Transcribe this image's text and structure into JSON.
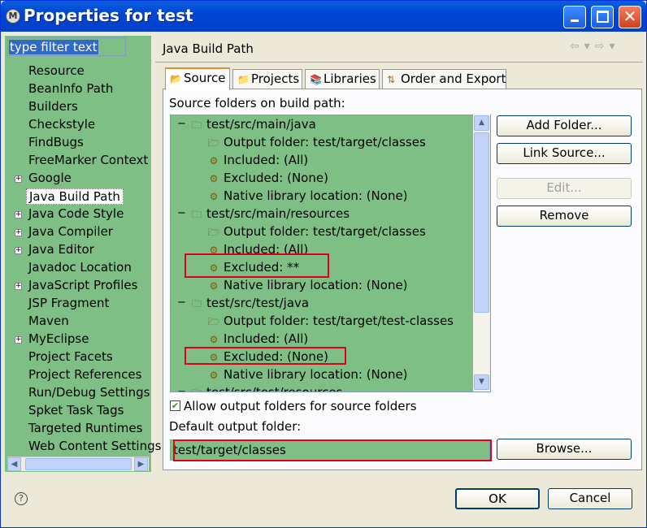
{
  "window": {
    "title": "Properties for test",
    "icon": "eclipse-icon"
  },
  "filter": {
    "placeholder": "type filter text"
  },
  "nav": {
    "items": [
      {
        "label": "Resource",
        "expandable": false
      },
      {
        "label": "BeanInfo Path",
        "expandable": false
      },
      {
        "label": "Builders",
        "expandable": false
      },
      {
        "label": "Checkstyle",
        "expandable": false
      },
      {
        "label": "FindBugs",
        "expandable": false
      },
      {
        "label": "FreeMarker Context",
        "expandable": false
      },
      {
        "label": "Google",
        "expandable": true
      },
      {
        "label": "Java Build Path",
        "expandable": false,
        "selected": true
      },
      {
        "label": "Java Code Style",
        "expandable": true
      },
      {
        "label": "Java Compiler",
        "expandable": true
      },
      {
        "label": "Java Editor",
        "expandable": true
      },
      {
        "label": "Javadoc Location",
        "expandable": false
      },
      {
        "label": "JavaScript Profiles",
        "expandable": true
      },
      {
        "label": "JSP Fragment",
        "expandable": false
      },
      {
        "label": "Maven",
        "expandable": false
      },
      {
        "label": "MyEclipse",
        "expandable": true
      },
      {
        "label": "Project Facets",
        "expandable": false
      },
      {
        "label": "Project References",
        "expandable": false
      },
      {
        "label": "Run/Debug Settings",
        "expandable": false
      },
      {
        "label": "Spket Task Tags",
        "expandable": false
      },
      {
        "label": "Targeted Runtimes",
        "expandable": false
      },
      {
        "label": "Web Content Settings",
        "expandable": false
      }
    ]
  },
  "page": {
    "title": "Java Build Path",
    "tabs": [
      {
        "label": "Source",
        "icon": "source-folder-icon",
        "active": true
      },
      {
        "label": "Projects",
        "icon": "projects-icon"
      },
      {
        "label": "Libraries",
        "icon": "libraries-icon"
      },
      {
        "label": "Order and Export",
        "icon": "order-export-icon"
      }
    ],
    "source_label": "Source folders on build path:",
    "tree": [
      {
        "label": "test/src/main/java",
        "level": 0,
        "icon": "package-folder-icon"
      },
      {
        "label": "Output folder: test/target/classes",
        "level": 1,
        "icon": "output-folder-icon"
      },
      {
        "label": "Included: (All)",
        "level": 1,
        "icon": "filter-icon"
      },
      {
        "label": "Excluded: (None)",
        "level": 1,
        "icon": "filter-icon"
      },
      {
        "label": "Native library location: (None)",
        "level": 1,
        "icon": "native-lib-icon"
      },
      {
        "label": "test/src/main/resources",
        "level": 0,
        "icon": "package-folder-icon"
      },
      {
        "label": "Output folder: test/target/classes",
        "level": 1,
        "icon": "output-folder-icon"
      },
      {
        "label": "Included: (All)",
        "level": 1,
        "icon": "filter-icon"
      },
      {
        "label": "Excluded: **",
        "level": 1,
        "icon": "filter-icon",
        "highlighted": true
      },
      {
        "label": "Native library location: (None)",
        "level": 1,
        "icon": "native-lib-icon"
      },
      {
        "label": "test/src/test/java",
        "level": 0,
        "icon": "package-folder-icon"
      },
      {
        "label": "Output folder: test/target/test-classes",
        "level": 1,
        "icon": "output-folder-icon"
      },
      {
        "label": "Included: (All)",
        "level": 1,
        "icon": "filter-icon"
      },
      {
        "label": "Excluded: (None)",
        "level": 1,
        "icon": "filter-icon",
        "highlighted": true
      },
      {
        "label": "Native library location: (None)",
        "level": 1,
        "icon": "native-lib-icon"
      },
      {
        "label": "test/src/test/resources",
        "level": 0,
        "icon": "package-folder-icon"
      }
    ],
    "buttons": {
      "add_folder": "Add Folder...",
      "link_source": "Link Source...",
      "edit": "Edit...",
      "remove": "Remove",
      "browse": "Browse..."
    },
    "allow_output_label": "Allow output folders for source folders",
    "allow_output_checked": true,
    "default_output_label": "Default output folder:",
    "default_output_value": "test/target/classes"
  },
  "footer": {
    "ok": "OK",
    "cancel": "Cancel"
  },
  "colors": {
    "list_bg": "#7dbf85",
    "highlight_border": "#e0001a",
    "titlebar": "#0046d5"
  }
}
